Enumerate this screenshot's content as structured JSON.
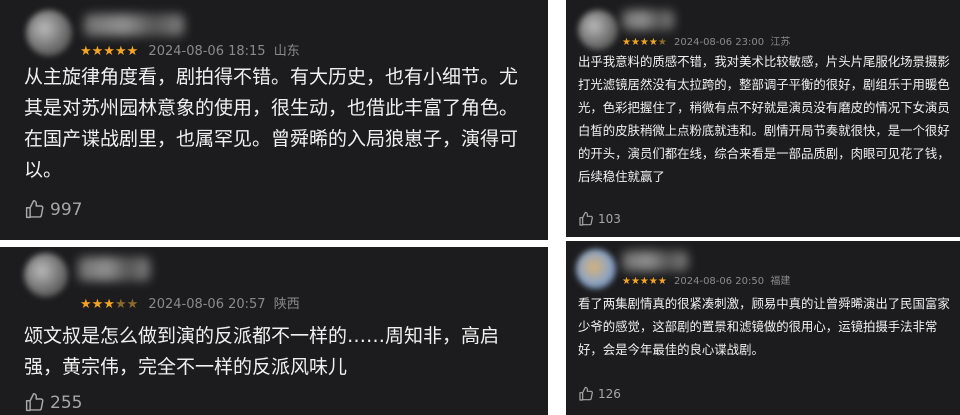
{
  "reviews": [
    {
      "stars": "★★★★★",
      "stars_dim": "",
      "date": "2024-08-06 18:15",
      "location": "山东",
      "text": "从主旋律角度看，剧拍得不错。有大历史，也有小细节。尤其是对苏州园林意象的使用，很生动，也借此丰富了角色。在国产谍战剧里，也属罕见。曾舜晞的入局狼崽子，演得可以。",
      "likes": "997"
    },
    {
      "stars": "★★★",
      "stars_dim": "★★",
      "date": "2024-08-06 20:57",
      "location": "陕西",
      "text": "颂文叔是怎么做到演的反派都不一样的……周知非，高启强，黄宗伟，完全不一样的反派风味儿",
      "likes": "255"
    },
    {
      "stars": "★★★★",
      "stars_dim": "★",
      "date": "2024-08-06 23:00",
      "location": "江苏",
      "text": "出乎我意料的质感不错，我对美术比较敏感，片头片尾服化场景摄影打光滤镜居然没有太拉跨的，整部调子平衡的很好，剧组乐于用暖色光，色彩把握住了，稍微有点不好就是演员没有磨皮的情况下女演员白皙的皮肤稍微上点粉底就违和。剧情开局节奏就很快，是一个很好的开头，演员们都在线，综合来看是一部品质剧，肉眼可见花了钱，后续稳住就赢了",
      "likes": "103"
    },
    {
      "stars": "★★★★★",
      "stars_dim": "",
      "date": "2024-08-06 20:50",
      "location": "福建",
      "text": "看了两集剧情真的很紧凑刺激，顾易中真的让曾舜晞演出了民国富家少爷的感觉，这部剧的置景和滤镜做的很用心，运镜拍摄手法非常好，会是今年最佳的良心谍战剧。",
      "likes": "126"
    }
  ],
  "icons": {
    "like": "thumbs-up-icon"
  },
  "colors": {
    "card_bg": "#1c1c1e",
    "star": "#f4a425",
    "meta": "#8a8a8a",
    "text": "#f0f0f0"
  }
}
